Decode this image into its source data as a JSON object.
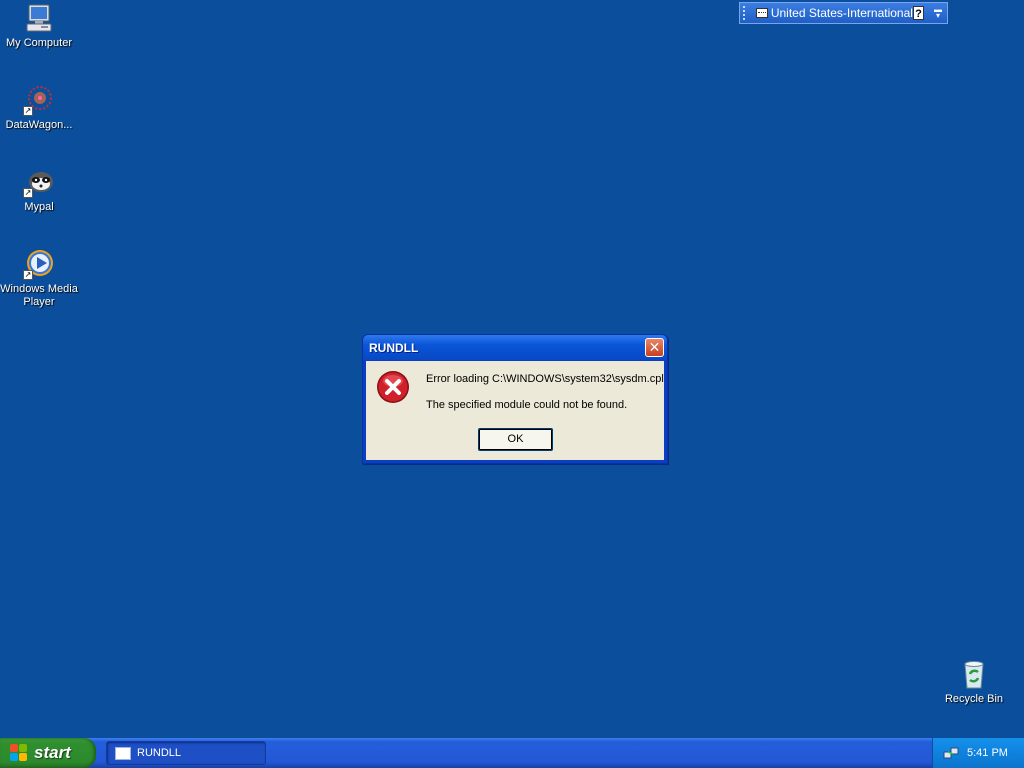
{
  "desktop": {
    "icons": [
      {
        "label": "My Computer",
        "icon": "my-computer-icon"
      },
      {
        "label": "DataWagon...",
        "icon": "datawagon-icon"
      },
      {
        "label": "Mypal",
        "icon": "mypal-icon"
      },
      {
        "label": "Windows Media Player",
        "icon": "windows-media-player-icon"
      },
      {
        "label": "Recycle Bin",
        "icon": "recycle-bin-icon"
      }
    ]
  },
  "language_bar": {
    "language": "United States-International",
    "help_label": "?"
  },
  "dialog": {
    "title": "RUNDLL",
    "close_label": "✕",
    "message_line1": "Error loading C:\\WINDOWS\\system32\\sysdm.cpl",
    "message_line2": "The specified module could not be found.",
    "ok_label": "OK",
    "icon": "error-icon"
  },
  "taskbar": {
    "start_label": "start",
    "tasks": [
      {
        "label": "RUNDLL"
      }
    ],
    "clock": "5:41 PM"
  },
  "colors": {
    "desktop_background": "#0b4f9c",
    "taskbar": "#245edb",
    "start_button": "#2f8f2f",
    "dialog_face": "#ece9d8",
    "error_red": "#d0202a"
  }
}
